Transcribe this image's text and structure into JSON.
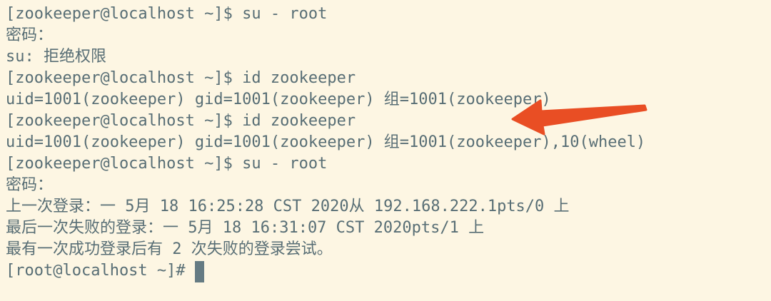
{
  "terminal": {
    "lines": [
      "[zookeeper@localhost ~]$ su - root",
      "密码：",
      "su: 拒绝权限",
      "[zookeeper@localhost ~]$ id zookeeper",
      "uid=1001(zookeeper) gid=1001(zookeeper) 组=1001(zookeeper)",
      "[zookeeper@localhost ~]$ id zookeeper",
      "uid=1001(zookeeper) gid=1001(zookeeper) 组=1001(zookeeper),10(wheel)",
      "[zookeeper@localhost ~]$ su - root",
      "密码：",
      "上一次登录：一 5月 18 16:25:28 CST 2020从 192.168.222.1pts/0 上",
      "最后一次失败的登录：一 5月 18 16:31:07 CST 2020pts/1 上",
      "最有一次成功登录后有 2 次失败的登录尝试。",
      "[root@localhost ~]# "
    ]
  },
  "colors": {
    "background": "#fdf6e3",
    "text": "#586e75",
    "arrow": "#e94e24",
    "cursor": "#657b83"
  },
  "annotation": {
    "icon": "arrow-left-icon"
  }
}
